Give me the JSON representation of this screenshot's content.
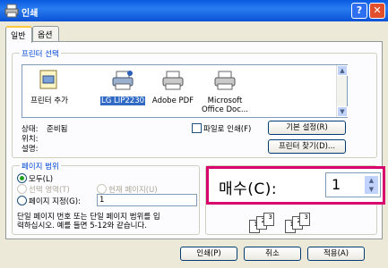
{
  "window": {
    "title": "인쇄",
    "help_button": "?",
    "close_button": "✕"
  },
  "tabs": [
    {
      "label": "일반",
      "active": true
    },
    {
      "label": "옵션",
      "active": false
    }
  ],
  "printer_select": {
    "group_label": "프린터 선택",
    "printers": [
      {
        "label": "프린터 추가",
        "icon": "add-printer-icon",
        "selected": false
      },
      {
        "label": "LG LIP2230",
        "icon": "printer-icon",
        "selected": true
      },
      {
        "label": "Adobe PDF",
        "icon": "printer-icon",
        "selected": false
      },
      {
        "label": "Microsoft Office Doc...",
        "line1": "Microsoft",
        "line2": "Office Doc...",
        "icon": "printer-icon",
        "selected": false
      }
    ],
    "status_label": "상태:",
    "status_value": "준비됨",
    "location_label": "위치:",
    "comment_label": "설명:",
    "print_to_file": "파일로 인쇄(F)",
    "preferences_button": "기본 설정(R)",
    "find_printer_button": "프린터 찾기(D)..."
  },
  "page_range": {
    "group_label": "페이지 범위",
    "all": "모두(L)",
    "selection": "선택 영역(T)",
    "current_page": "현재 페이지(U)",
    "pages": "페이지 지정(G):",
    "pages_value": "1",
    "help_line1": "단일 페이지 번호 또는 단일 페이지 범위를 입",
    "help_line2": "력하십시오. 예를 들면 5-12와 같습니다."
  },
  "copies": {
    "label": "매수(C):",
    "value": "1",
    "spin_up": "▲",
    "spin_down": "▼"
  },
  "collate_pages": [
    "1",
    "2",
    "3",
    "1",
    "2",
    "3"
  ],
  "footer": {
    "print_button": "인쇄(P)",
    "cancel_button": "취소",
    "apply_button": "적용(A)"
  },
  "colors": {
    "titlebar": "#0a5ae0",
    "highlight": "#d8006c",
    "selected": "#316ac5"
  }
}
